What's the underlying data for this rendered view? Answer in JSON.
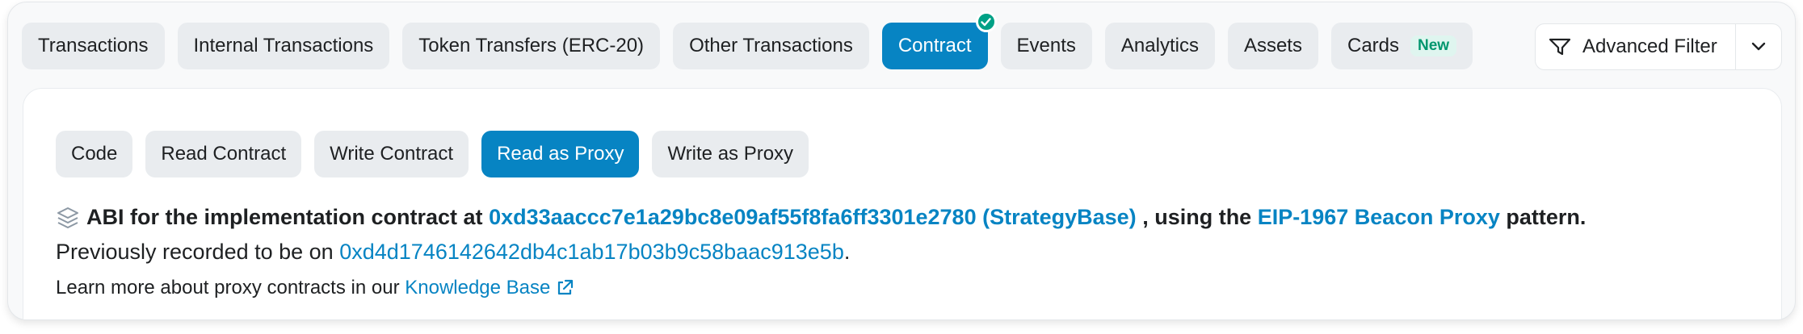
{
  "colors": {
    "accent": "#0784c3",
    "tab_bg": "#e9ecef",
    "success": "#00a186",
    "new_badge_bg": "#dff5ef",
    "new_badge_text": "#00966e"
  },
  "top_tabs": [
    {
      "label": "Transactions"
    },
    {
      "label": "Internal Transactions"
    },
    {
      "label": "Token Transfers (ERC-20)"
    },
    {
      "label": "Other Transactions"
    },
    {
      "label": "Contract",
      "active": true,
      "verified_icon": "check-circle-icon"
    },
    {
      "label": "Events"
    },
    {
      "label": "Analytics"
    },
    {
      "label": "Assets"
    },
    {
      "label": "Cards",
      "badge": "New"
    }
  ],
  "filter": {
    "label": "Advanced Filter",
    "icon": "filter-icon",
    "caret_icon": "chevron-down-icon"
  },
  "sub_tabs": [
    {
      "label": "Code"
    },
    {
      "label": "Read Contract"
    },
    {
      "label": "Write Contract"
    },
    {
      "label": "Read as Proxy",
      "active": true
    },
    {
      "label": "Write as Proxy"
    }
  ],
  "proxy_info": {
    "icon": "layers-icon",
    "prefix": "ABI for the implementation contract at",
    "implementation_address": "0xd33aaccc7e1a29bc8e09af55f8fa6ff3301e2780",
    "implementation_name": "(StrategyBase)",
    "middle": ", using the",
    "pattern_link": "EIP-1967 Beacon Proxy",
    "suffix": "pattern.",
    "previous_prefix": "Previously recorded to be on",
    "previous_address": "0xd4d1746142642db4c1ab17b03b9c58baac913e5b",
    "previous_suffix": ".",
    "learn_more": "Learn more about proxy contracts in our",
    "kb_link": "Knowledge Base",
    "kb_icon": "external-link-icon"
  }
}
